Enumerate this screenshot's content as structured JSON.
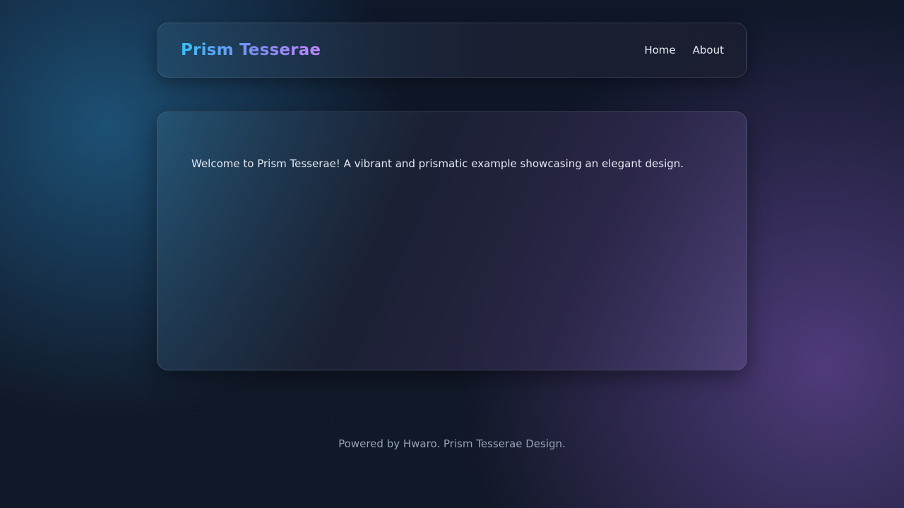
{
  "header": {
    "brand": "Prism Tesserae",
    "nav": [
      {
        "label": "Home"
      },
      {
        "label": "About"
      }
    ]
  },
  "main": {
    "welcome_text": "Welcome to Prism Tesserae! A vibrant and prismatic example showcasing an elegant design."
  },
  "footer": {
    "text": "Powered by Hwaro. Prism Tesserae Design."
  },
  "colors": {
    "brand_gradient_start": "#38bdf8",
    "brand_gradient_mid": "#818cf8",
    "brand_gradient_end": "#c084fc",
    "text_primary": "#e2e8f0",
    "text_muted": "#94a3b8",
    "background": "#0f172a"
  }
}
